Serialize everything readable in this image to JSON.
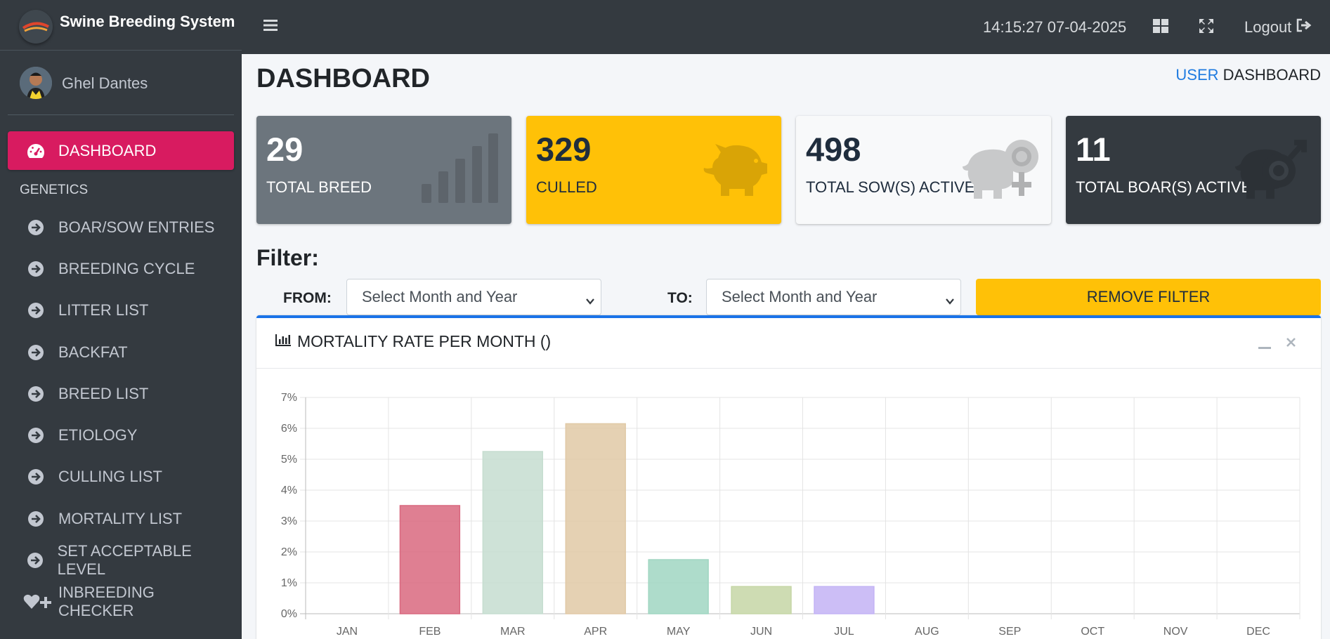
{
  "brand": {
    "title": "Swine Breeding System"
  },
  "user": {
    "name": "Ghel Dantes"
  },
  "sidebar": {
    "active": "DASHBOARD",
    "header": "GENETICS",
    "items": [
      "BOAR/SOW ENTRIES",
      "BREEDING CYCLE",
      "LITTER LIST",
      "BACKFAT",
      "BREED LIST",
      "ETIOLOGY",
      "CULLING LIST",
      "MORTALITY LIST",
      "SET ACCEPTABLE LEVEL"
    ],
    "last": "INBREEDING CHECKER"
  },
  "topbar": {
    "datetime": "14:15:27 07-04-2025",
    "logout": "Logout"
  },
  "page": {
    "title": "DASHBOARD",
    "crumb_link": "USER",
    "crumb_current": "DASHBOARD"
  },
  "stats": [
    {
      "value": "29",
      "label": "TOTAL BREED",
      "color": "#6c757d"
    },
    {
      "value": "329",
      "label": "CULLED",
      "color": "#ffc107"
    },
    {
      "value": "498",
      "label": "TOTAL SOW(S) ACTIVE",
      "color": "#f8f9fa"
    },
    {
      "value": "11",
      "label": "TOTAL BOAR(S) ACTIVE",
      "color": "#343a40"
    }
  ],
  "filter": {
    "title": "Filter:",
    "from_label": "FROM:",
    "to_label": "TO:",
    "from_value": "Select Month and Year",
    "to_value": "Select Month and Year",
    "remove": "REMOVE FILTER"
  },
  "card": {
    "title": "MORTALITY RATE PER MONTH ()"
  },
  "chart_data": {
    "type": "bar",
    "categories": [
      "JAN",
      "FEB",
      "MAR",
      "APR",
      "MAY",
      "JUN",
      "JUL",
      "AUG",
      "SEP",
      "OCT",
      "NOV",
      "DEC"
    ],
    "values": [
      0,
      3.5,
      5.25,
      6.15,
      1.75,
      0.88,
      0.88,
      0,
      0,
      0,
      0,
      0
    ],
    "colors": [
      "#d9687f",
      "#d9687f",
      "#c6ddd0",
      "#e0c9a6",
      "#a0d6c2",
      "#c5d6a6",
      "#c3b3f5",
      "#d9687f",
      "#d9687f",
      "#d9687f",
      "#d9687f",
      "#d9687f"
    ],
    "ylim": [
      0,
      7
    ],
    "yticks": [
      "0%",
      "1%",
      "2%",
      "3%",
      "4%",
      "5%",
      "6%",
      "7%"
    ],
    "grid": true
  }
}
